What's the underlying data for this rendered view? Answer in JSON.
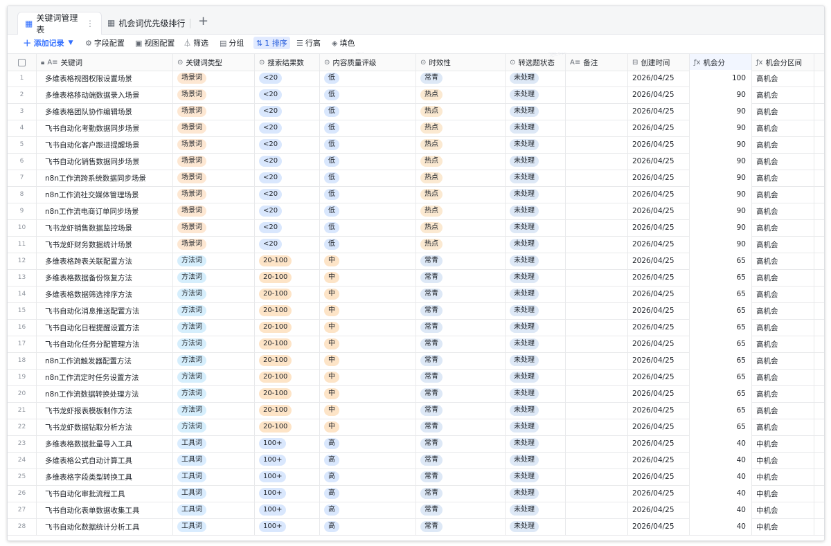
{
  "tabs": [
    {
      "label": "关键词管理表",
      "more": "⋮"
    },
    {
      "label": "机会词优先级排行"
    }
  ],
  "tab_add": "+",
  "toolbar": {
    "add": "添加记录",
    "fields": "字段配置",
    "views": "视图配置",
    "filter": "筛选",
    "group": "分组",
    "sort": "1 排序",
    "row_height": "行高",
    "fill": "填色"
  },
  "columns": [
    {
      "key": "keyword",
      "label": "关键词"
    },
    {
      "key": "type",
      "label": "关键词类型"
    },
    {
      "key": "results",
      "label": "搜索结果数"
    },
    {
      "key": "quality",
      "label": "内容质量评级"
    },
    {
      "key": "timeliness",
      "label": "时效性"
    },
    {
      "key": "status",
      "label": "转选题状态"
    },
    {
      "key": "note",
      "label": "备注"
    },
    {
      "key": "created",
      "label": "创建时间"
    },
    {
      "key": "score",
      "label": "机会分"
    },
    {
      "key": "range",
      "label": "机会分区间"
    }
  ],
  "colors": {
    "accent": "#3370ff",
    "tag_scene": "#fde7d2",
    "tag_method": "#d5eefc",
    "tag_tool": "#d9ecfe",
    "tag_blue": "#d9e7fd",
    "tag_orange": "#fde4c7",
    "tag_hot": "#fbe9d1",
    "tag_evergreen": "#dde8f6"
  },
  "rows": [
    {
      "n": "1",
      "keyword": "多维表格视图权限设置场景",
      "type": "场景词",
      "results": "<20",
      "quality": "低",
      "timeliness": "常青",
      "status": "未处理",
      "note": "",
      "created": "2026/04/25",
      "score": "100",
      "range": "高机会"
    },
    {
      "n": "2",
      "keyword": "多维表格移动端数据录入场景",
      "type": "场景词",
      "results": "<20",
      "quality": "低",
      "timeliness": "热点",
      "status": "未处理",
      "note": "",
      "created": "2026/04/25",
      "score": "90",
      "range": "高机会"
    },
    {
      "n": "3",
      "keyword": "多维表格团队协作编辑场景",
      "type": "场景词",
      "results": "<20",
      "quality": "低",
      "timeliness": "热点",
      "status": "未处理",
      "note": "",
      "created": "2026/04/25",
      "score": "90",
      "range": "高机会"
    },
    {
      "n": "4",
      "keyword": "飞书自动化考勤数据同步场景",
      "type": "场景词",
      "results": "<20",
      "quality": "低",
      "timeliness": "热点",
      "status": "未处理",
      "note": "",
      "created": "2026/04/25",
      "score": "90",
      "range": "高机会"
    },
    {
      "n": "5",
      "keyword": "飞书自动化客户跟进提醒场景",
      "type": "场景词",
      "results": "<20",
      "quality": "低",
      "timeliness": "热点",
      "status": "未处理",
      "note": "",
      "created": "2026/04/25",
      "score": "90",
      "range": "高机会"
    },
    {
      "n": "6",
      "keyword": "飞书自动化销售数据同步场景",
      "type": "场景词",
      "results": "<20",
      "quality": "低",
      "timeliness": "热点",
      "status": "未处理",
      "note": "",
      "created": "2026/04/25",
      "score": "90",
      "range": "高机会"
    },
    {
      "n": "7",
      "keyword": "n8n工作流跨系统数据同步场景",
      "type": "场景词",
      "results": "<20",
      "quality": "低",
      "timeliness": "热点",
      "status": "未处理",
      "note": "",
      "created": "2026/04/25",
      "score": "90",
      "range": "高机会"
    },
    {
      "n": "8",
      "keyword": "n8n工作流社交媒体管理场景",
      "type": "场景词",
      "results": "<20",
      "quality": "低",
      "timeliness": "热点",
      "status": "未处理",
      "note": "",
      "created": "2026/04/25",
      "score": "90",
      "range": "高机会"
    },
    {
      "n": "9",
      "keyword": "n8n工作流电商订单同步场景",
      "type": "场景词",
      "results": "<20",
      "quality": "低",
      "timeliness": "热点",
      "status": "未处理",
      "note": "",
      "created": "2026/04/25",
      "score": "90",
      "range": "高机会"
    },
    {
      "n": "10",
      "keyword": "飞书龙虾销售数据监控场景",
      "type": "场景词",
      "results": "<20",
      "quality": "低",
      "timeliness": "热点",
      "status": "未处理",
      "note": "",
      "created": "2026/04/25",
      "score": "90",
      "range": "高机会"
    },
    {
      "n": "11",
      "keyword": "飞书龙虾财务数据统计场景",
      "type": "场景词",
      "results": "<20",
      "quality": "低",
      "timeliness": "热点",
      "status": "未处理",
      "note": "",
      "created": "2026/04/25",
      "score": "90",
      "range": "高机会"
    },
    {
      "n": "12",
      "keyword": "多维表格跨表关联配置方法",
      "type": "方法词",
      "results": "20-100",
      "quality": "中",
      "timeliness": "常青",
      "status": "未处理",
      "note": "",
      "created": "2026/04/25",
      "score": "65",
      "range": "高机会"
    },
    {
      "n": "13",
      "keyword": "多维表格数据备份恢复方法",
      "type": "方法词",
      "results": "20-100",
      "quality": "中",
      "timeliness": "常青",
      "status": "未处理",
      "note": "",
      "created": "2026/04/25",
      "score": "65",
      "range": "高机会"
    },
    {
      "n": "14",
      "keyword": "多维表格数据筛选排序方法",
      "type": "方法词",
      "results": "20-100",
      "quality": "中",
      "timeliness": "常青",
      "status": "未处理",
      "note": "",
      "created": "2026/04/25",
      "score": "65",
      "range": "高机会"
    },
    {
      "n": "15",
      "keyword": "飞书自动化消息推送配置方法",
      "type": "方法词",
      "results": "20-100",
      "quality": "中",
      "timeliness": "常青",
      "status": "未处理",
      "note": "",
      "created": "2026/04/25",
      "score": "65",
      "range": "高机会"
    },
    {
      "n": "16",
      "keyword": "飞书自动化日程提醒设置方法",
      "type": "方法词",
      "results": "20-100",
      "quality": "中",
      "timeliness": "常青",
      "status": "未处理",
      "note": "",
      "created": "2026/04/25",
      "score": "65",
      "range": "高机会"
    },
    {
      "n": "17",
      "keyword": "飞书自动化任务分配管理方法",
      "type": "方法词",
      "results": "20-100",
      "quality": "中",
      "timeliness": "常青",
      "status": "未处理",
      "note": "",
      "created": "2026/04/25",
      "score": "65",
      "range": "高机会"
    },
    {
      "n": "18",
      "keyword": "n8n工作流触发器配置方法",
      "type": "方法词",
      "results": "20-100",
      "quality": "中",
      "timeliness": "常青",
      "status": "未处理",
      "note": "",
      "created": "2026/04/25",
      "score": "65",
      "range": "高机会"
    },
    {
      "n": "19",
      "keyword": "n8n工作流定时任务设置方法",
      "type": "方法词",
      "results": "20-100",
      "quality": "中",
      "timeliness": "常青",
      "status": "未处理",
      "note": "",
      "created": "2026/04/25",
      "score": "65",
      "range": "高机会"
    },
    {
      "n": "20",
      "keyword": "n8n工作流数据转换处理方法",
      "type": "方法词",
      "results": "20-100",
      "quality": "中",
      "timeliness": "常青",
      "status": "未处理",
      "note": "",
      "created": "2026/04/25",
      "score": "65",
      "range": "高机会"
    },
    {
      "n": "21",
      "keyword": "飞书龙虾报表模板制作方法",
      "type": "方法词",
      "results": "20-100",
      "quality": "中",
      "timeliness": "常青",
      "status": "未处理",
      "note": "",
      "created": "2026/04/25",
      "score": "65",
      "range": "高机会"
    },
    {
      "n": "22",
      "keyword": "飞书龙虾数据钻取分析方法",
      "type": "方法词",
      "results": "20-100",
      "quality": "中",
      "timeliness": "常青",
      "status": "未处理",
      "note": "",
      "created": "2026/04/25",
      "score": "65",
      "range": "高机会"
    },
    {
      "n": "23",
      "keyword": "多维表格数据批量导入工具",
      "type": "工具词",
      "results": "100+",
      "quality": "高",
      "timeliness": "常青",
      "status": "未处理",
      "note": "",
      "created": "2026/04/25",
      "score": "40",
      "range": "中机会"
    },
    {
      "n": "24",
      "keyword": "多维表格公式自动计算工具",
      "type": "工具词",
      "results": "100+",
      "quality": "高",
      "timeliness": "常青",
      "status": "未处理",
      "note": "",
      "created": "2026/04/25",
      "score": "40",
      "range": "中机会"
    },
    {
      "n": "25",
      "keyword": "多维表格字段类型转换工具",
      "type": "工具词",
      "results": "100+",
      "quality": "高",
      "timeliness": "常青",
      "status": "未处理",
      "note": "",
      "created": "2026/04/25",
      "score": "40",
      "range": "中机会"
    },
    {
      "n": "26",
      "keyword": "飞书自动化审批流程工具",
      "type": "工具词",
      "results": "100+",
      "quality": "高",
      "timeliness": "常青",
      "status": "未处理",
      "note": "",
      "created": "2026/04/25",
      "score": "40",
      "range": "中机会"
    },
    {
      "n": "27",
      "keyword": "飞书自动化表单数据收集工具",
      "type": "工具词",
      "results": "100+",
      "quality": "高",
      "timeliness": "常青",
      "status": "未处理",
      "note": "",
      "created": "2026/04/25",
      "score": "40",
      "range": "中机会"
    },
    {
      "n": "28",
      "keyword": "飞书自动化数据统计分析工具",
      "type": "工具词",
      "results": "100+",
      "quality": "高",
      "timeliness": "常青",
      "status": "未处理",
      "note": "",
      "created": "2026/04/25",
      "score": "40",
      "range": "中机会"
    }
  ]
}
